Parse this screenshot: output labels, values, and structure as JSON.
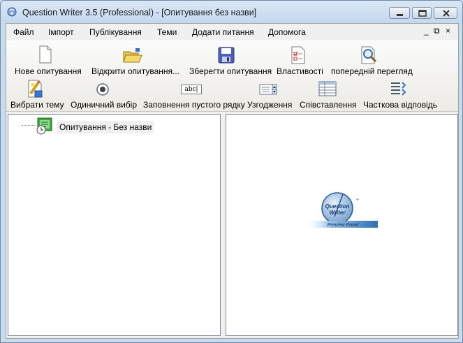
{
  "window": {
    "title": "Question Writer 3.5 (Professional) - [Опитування без назви]"
  },
  "menu": {
    "items": [
      "Файл",
      "Імпорт",
      "Публікування",
      "Теми",
      "Додати питання",
      "Допомога"
    ],
    "mdi_controls": [
      "_",
      "⧉",
      "×"
    ]
  },
  "toolbar": {
    "row1": [
      {
        "label": "Нове опитування",
        "icon": "new-document-icon"
      },
      {
        "label": "Відкрити опитування...",
        "icon": "open-folder-icon"
      },
      {
        "label": "Зберегти опитування",
        "icon": "save-disk-icon"
      },
      {
        "label": "Властивості",
        "icon": "properties-icon"
      },
      {
        "label": "попередній перегляд",
        "icon": "preview-magnifier-icon"
      }
    ],
    "row2": [
      {
        "label": "Вибрати тему",
        "icon": "theme-icon"
      },
      {
        "label": "Одиничний вибір",
        "icon": "radio-button-icon"
      },
      {
        "label": "Заповнення пустого рядку",
        "icon": "fill-blank-icon",
        "icon_text": "abc|"
      },
      {
        "label": "Узгодження",
        "icon": "list-spinner-icon"
      },
      {
        "label": "Співставлення",
        "icon": "matching-table-icon"
      },
      {
        "label": "Часткова відповідь",
        "icon": "partial-answer-icon"
      }
    ]
  },
  "tree": {
    "root_label": "Опитування - Без назви"
  },
  "preview": {
    "logo_line1": "Question",
    "logo_line2": "Writer",
    "logo_tm": "™",
    "logo_banner": "Preview Panel"
  },
  "colors": {
    "title_bar": "#c4d8ee",
    "client_bg": "#f0f0f0",
    "pane_bg": "#ffffff",
    "logo_blue": "#2f6fb5"
  }
}
